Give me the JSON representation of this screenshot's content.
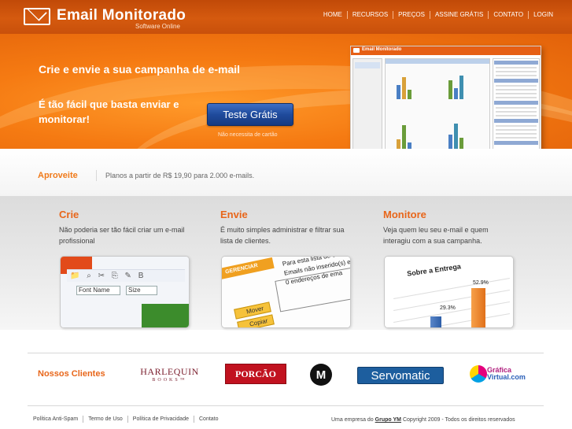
{
  "header": {
    "logo_title": "Email Monitorado",
    "logo_subtitle": "Software Online",
    "nav": [
      "HOME",
      "RECURSOS",
      "PREÇOS",
      "ASSINE GRÁTIS",
      "CONTATO",
      "LOGIN"
    ]
  },
  "banner": {
    "headline": "Crie e envie a sua campanha de e-mail",
    "text": "É tão fácil que basta enviar e monitorar!",
    "cta_label": "Teste Grátis",
    "cta_note": "Não necessita de cartão",
    "app_title": "Email Monitorado"
  },
  "promo": {
    "label": "Aproveite",
    "text": "Planos a partir de R$ 19,90 para 2.000 e-mails."
  },
  "features": [
    {
      "title": "Crie",
      "desc": "Não poderia ser tão fácil criar um e-mail profissional"
    },
    {
      "title": "Envie",
      "desc": "É muito simples administrar e filtrar sua lista de clientes."
    },
    {
      "title": "Monitore",
      "desc": "Veja quem leu seu e-mail e quem interagiu com a sua campanha."
    }
  ],
  "feature_images": {
    "crie": {
      "font_name": "Font Name",
      "size": "Size"
    },
    "envie": {
      "tab": "GERENCIAR",
      "lines": [
        "Para esta lista de en",
        "Emails não inserido(s) e",
        "0 endereços de ema"
      ],
      "btn_move": "Mover",
      "btn_copy": "Copiar"
    },
    "monitore": {
      "title": "Sobre a Entrega",
      "value_high": "52.9%",
      "value_low": "29.3%"
    }
  },
  "clients": {
    "label": "Nossos Clientes",
    "harlequin": "HARLEQUIN",
    "harlequin_sub": "BOOKS™",
    "porcao": "PORCÃO",
    "motorola": "M",
    "servomatic": "Servomatic",
    "grafica_1": "Gráfica",
    "grafica_2": "Virtual.com"
  },
  "footer": {
    "links": [
      "Política Anti-Spam",
      "Termo de Uso",
      "Política de Privacidade",
      "Contato"
    ],
    "copy_prefix": "Uma empresa do",
    "copy_brand": "Grupo YM",
    "copy_suffix": "Copyright 2009 - Todos os direitos reservados"
  },
  "colors": {
    "header_orange": "#c8500b",
    "banner_orange": "#f57a12",
    "accent": "#e8661a",
    "cta_blue": "#1f4b9c"
  },
  "icons": [
    "envelope-icon",
    "format-toolbar-icons",
    "motorola-logo-icon",
    "grafica-logo-icon"
  ]
}
